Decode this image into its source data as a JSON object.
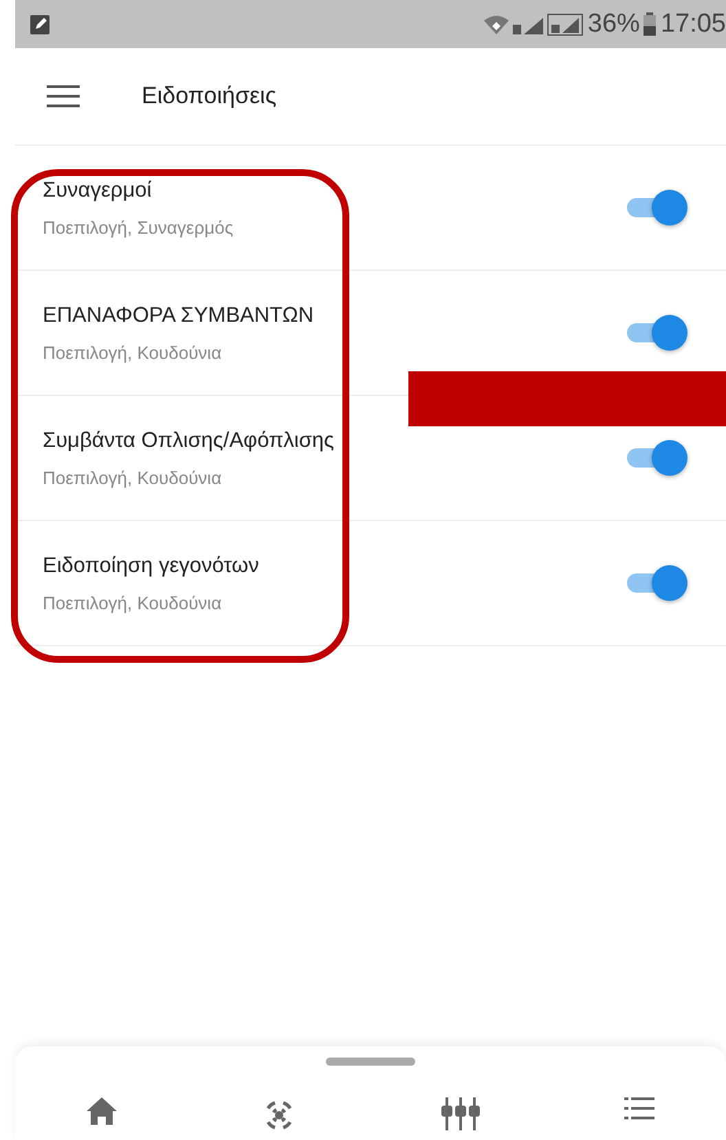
{
  "status_bar": {
    "battery": "36%",
    "time": "17:05"
  },
  "app_bar": {
    "title": "Ειδοποιήσεις"
  },
  "settings": [
    {
      "title": "Συναγερμοί",
      "subtitle": "Ποεπιλογή, Συναγερμός",
      "on": true
    },
    {
      "title": "ΕΠΑΝΑΦΟΡΑ ΣΥΜΒΑΝΤΩΝ",
      "subtitle": "Ποεπιλογή, Κουδούνια",
      "on": true
    },
    {
      "title": "Συμβάντα Οπλισης/Αφόπλισης",
      "subtitle": "Ποεπιλογή, Κουδούνια",
      "on": true
    },
    {
      "title": "Ειδοποίηση γεγονότων",
      "subtitle": "Ποεπιλογή, Κουδούνια",
      "on": true
    }
  ]
}
